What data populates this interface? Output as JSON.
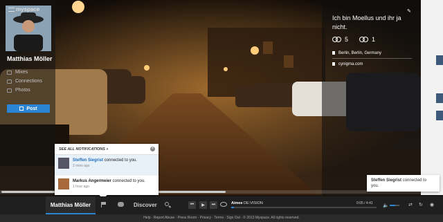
{
  "profile": {
    "name": "Matthias Möller",
    "nav": [
      "Mixes",
      "Connections",
      "Photos"
    ],
    "post_label": "Post"
  },
  "bio": {
    "text": "Ich bin Moellus und ihr ja nicht.",
    "stats": [
      {
        "icon": "connections-icon",
        "value": "5"
      },
      {
        "icon": "connected-icon",
        "value": "1"
      }
    ],
    "location": "Berlin, Berlin, Germany",
    "website": "cynigma.com"
  },
  "notifications": {
    "header": "SEE ALL NOTIFICATIONS »",
    "items": [
      {
        "name": "Steffen Siegrist",
        "text": "connected to you.",
        "ago": "2 mins ago"
      },
      {
        "name": "Markus Angermeier",
        "text": "connected to you.",
        "ago": "1 hour ago"
      }
    ]
  },
  "toast": {
    "name": "Steffen Siegrist",
    "text": "connected to you."
  },
  "player": {
    "logo": "myspace",
    "user_tab": "Matthias Möller",
    "discover": "Discover",
    "artist": "Aimee",
    "track": "DE:VISION",
    "time": "0:05 / 4:41",
    "progress": 0.02,
    "volume": 0.6
  },
  "footer": "Help · Report Abuse · Press Room · Privacy · Terms · Sign Out · © 2013 Myspace. All rights reserved.",
  "colors": {
    "accent": "#2a86d4",
    "bar": "#1f1f1f"
  }
}
